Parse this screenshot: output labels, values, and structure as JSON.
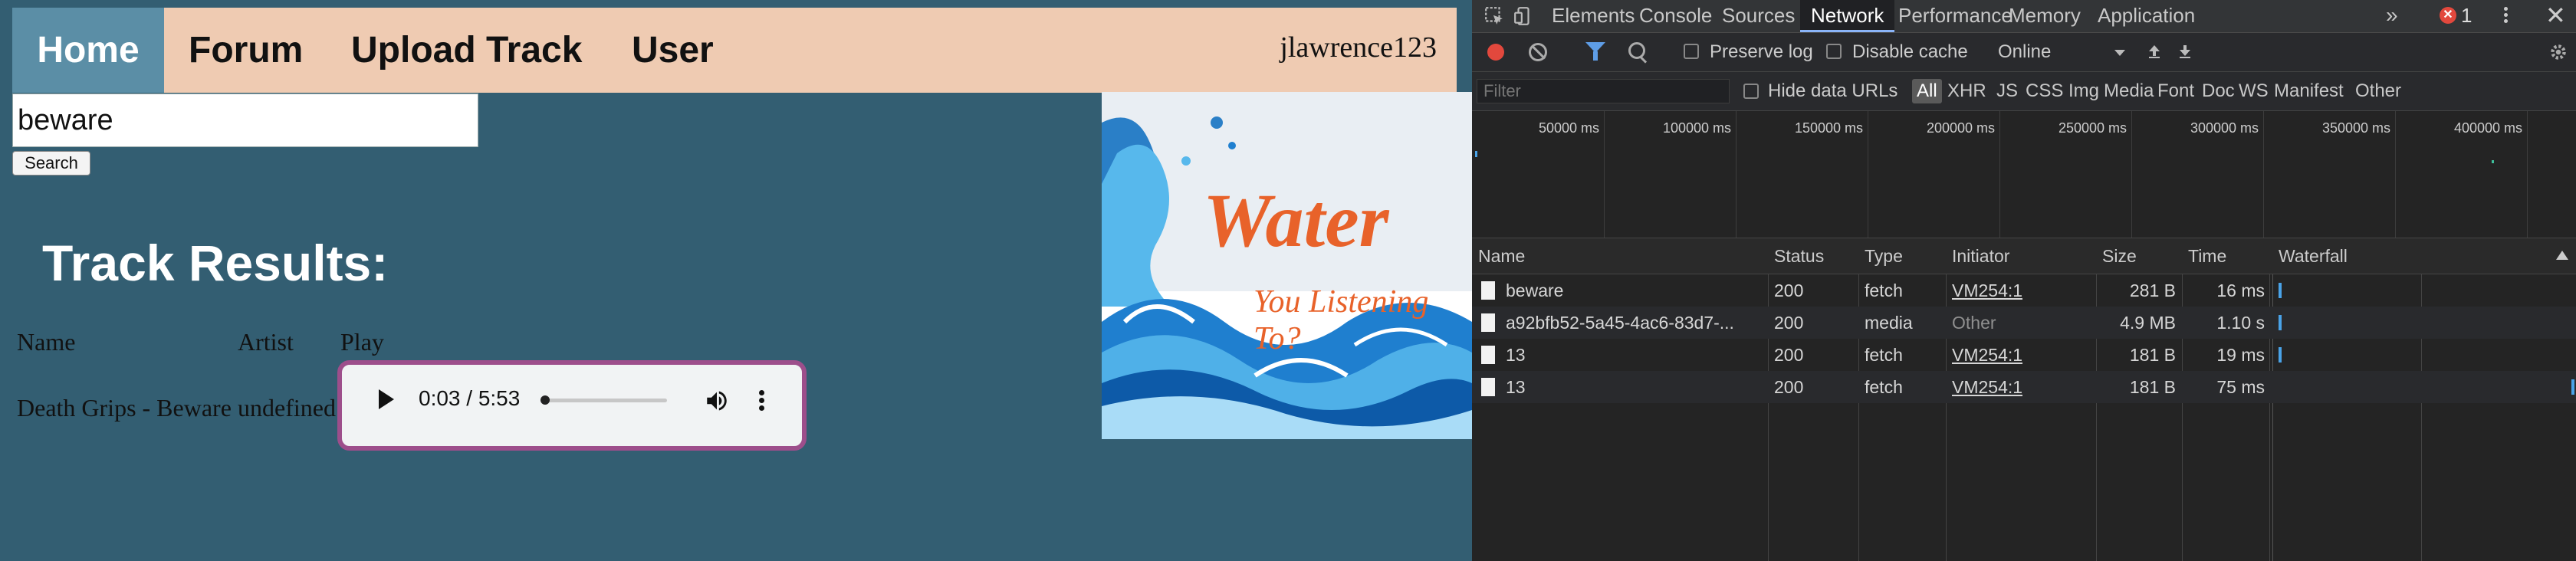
{
  "nav": {
    "home": "Home",
    "forum": "Forum",
    "upload": "Upload Track",
    "user": "User",
    "username": "jlawrence123"
  },
  "search": {
    "value": "beware",
    "button": "Search"
  },
  "results": {
    "title": "Track Results:",
    "headers": {
      "name": "Name",
      "artist": "Artist",
      "play": "Play"
    },
    "rows": [
      {
        "name": "Death Grips - Beware",
        "artist": "undefined"
      }
    ]
  },
  "audio": {
    "time": "0:03 / 5:53",
    "progress": 0.0085
  },
  "banner": {
    "title": "Water",
    "subtitle": "You Listening To?"
  },
  "devtools": {
    "tabs": [
      "Elements",
      "Console",
      "Sources",
      "Network",
      "Performance",
      "Memory",
      "Application"
    ],
    "active_tab": "Network",
    "more": "»",
    "error_count": "1",
    "close": "✕",
    "preserve_log": "Preserve log",
    "disable_cache": "Disable cache",
    "throttling": "Online",
    "filter_placeholder": "Filter",
    "hide_data_urls": "Hide data URLs",
    "filter_types": [
      "All",
      "XHR",
      "JS",
      "CSS",
      "Img",
      "Media",
      "Font",
      "Doc",
      "WS",
      "Manifest",
      "Other"
    ],
    "timeline_ticks": [
      "50000 ms",
      "100000 ms",
      "150000 ms",
      "200000 ms",
      "250000 ms",
      "300000 ms",
      "350000 ms",
      "400000 ms"
    ],
    "columns": {
      "name": "Name",
      "status": "Status",
      "type": "Type",
      "initiator": "Initiator",
      "size": "Size",
      "time": "Time",
      "waterfall": "Waterfall"
    },
    "requests": [
      {
        "name": "beware",
        "status": "200",
        "type": "fetch",
        "initiator": "VM254:1",
        "size": "281 B",
        "time": "16 ms"
      },
      {
        "name": "a92bfb52-5a45-4ac6-83d7-...",
        "status": "200",
        "type": "media",
        "initiator": "Other",
        "size": "4.9 MB",
        "time": "1.10 s"
      },
      {
        "name": "13",
        "status": "200",
        "type": "fetch",
        "initiator": "VM254:1",
        "size": "181 B",
        "time": "19 ms"
      },
      {
        "name": "13",
        "status": "200",
        "type": "fetch",
        "initiator": "VM254:1",
        "size": "181 B",
        "time": "75 ms"
      }
    ]
  },
  "colors": {
    "navbar": "#efcbb2",
    "home_active": "#5b8ea6",
    "page_bg": "#335e72",
    "focus_ring": "#9d4e8b",
    "banner_text": "#e8622a",
    "record": "#e2483d",
    "waterfall": "#4aa3e8"
  }
}
